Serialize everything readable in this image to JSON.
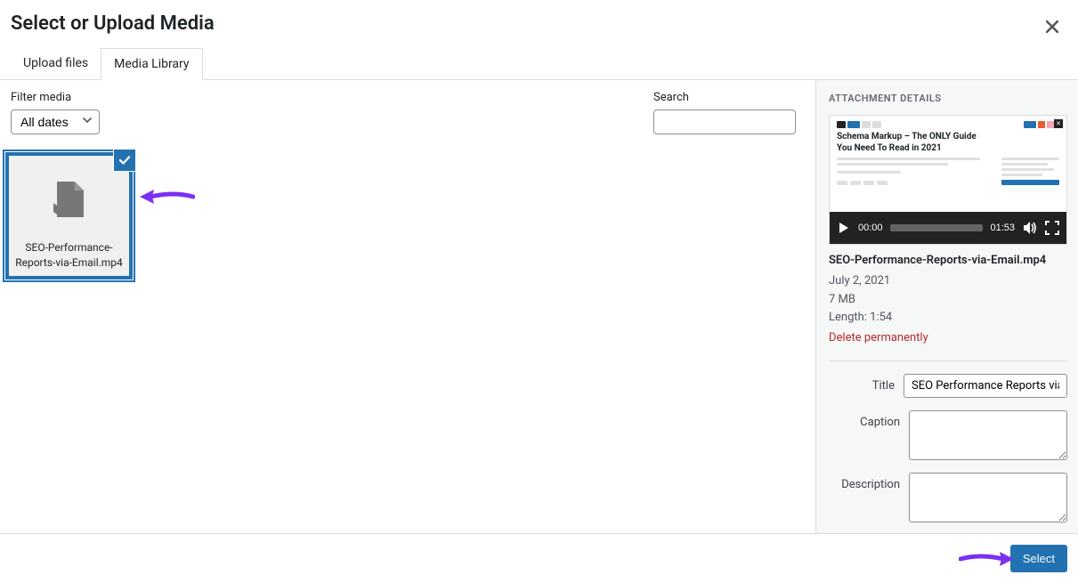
{
  "header": {
    "title": "Select or Upload Media"
  },
  "tabs": {
    "upload": "Upload files",
    "library": "Media Library"
  },
  "toolbar": {
    "filter_label": "Filter media",
    "filter_value": "All dates",
    "search_label": "Search"
  },
  "media": {
    "items": [
      {
        "filename": "SEO-Performance-Reports-via-Email.mp4"
      }
    ]
  },
  "details": {
    "section_title": "ATTACHMENT DETAILS",
    "preview_heading": "Schema Markup – The ONLY Guide You Need To Read in 2021",
    "player": {
      "current": "00:00",
      "duration": "01:53"
    },
    "filename": "SEO-Performance-Reports-via-Email.mp4",
    "date": "July 2, 2021",
    "size": "7 MB",
    "length_label": "Length: 1:54",
    "delete_label": "Delete permanently",
    "fields": {
      "title_label": "Title",
      "title_value": "SEO Performance Reports via Email",
      "caption_label": "Caption",
      "caption_value": "",
      "description_label": "Description",
      "description_value": ""
    }
  },
  "footer": {
    "select_label": "Select"
  }
}
